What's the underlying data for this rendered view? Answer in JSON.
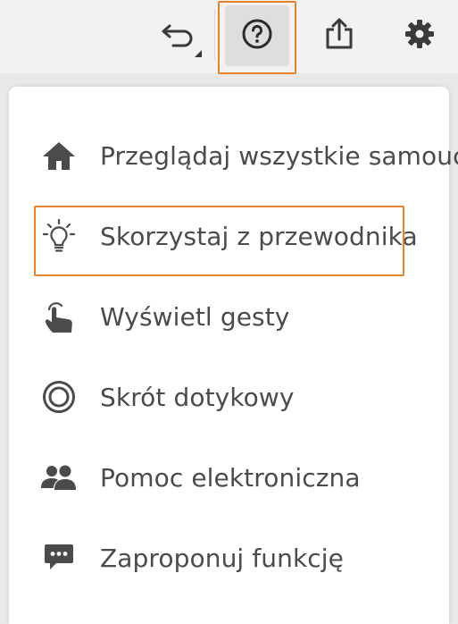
{
  "toolbar": {
    "undo_icon": "undo-icon",
    "help_icon": "help-circle-icon",
    "share_icon": "share-icon",
    "settings_icon": "gear-icon",
    "highlight_color": "#e8822a"
  },
  "menu": {
    "items": [
      {
        "label": "Przeglądaj wszystkie samoucz",
        "icon": "home-icon"
      },
      {
        "label": "Skorzystaj z przewodnika",
        "icon": "lightbulb-icon"
      },
      {
        "label": "Wyświetl gesty",
        "icon": "touch-gesture-icon"
      },
      {
        "label": "Skrót dotykowy",
        "icon": "touch-shortcut-icon"
      },
      {
        "label": "Pomoc elektroniczna",
        "icon": "people-icon"
      },
      {
        "label": "Zaproponuj funkcję",
        "icon": "feedback-bubble-icon"
      }
    ]
  }
}
